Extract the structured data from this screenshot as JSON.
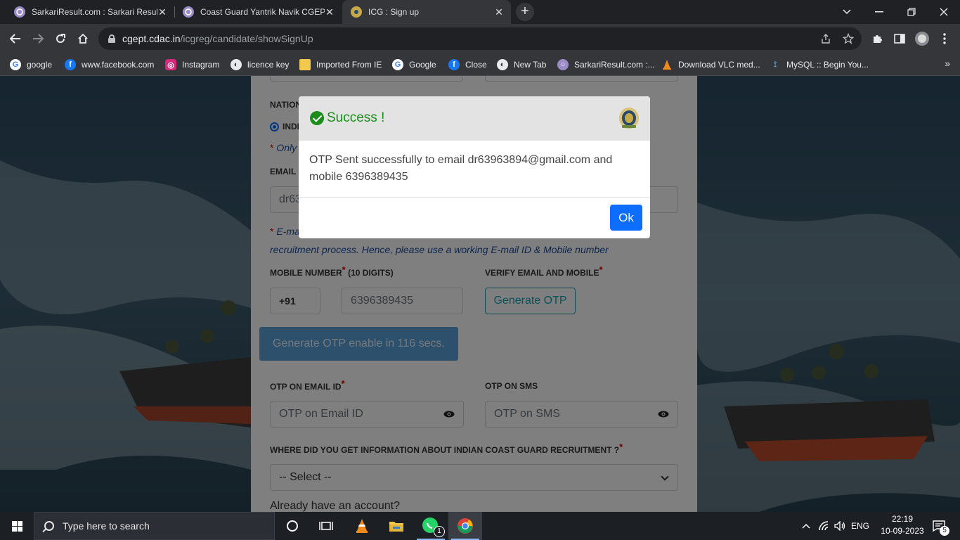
{
  "browser": {
    "tabs": [
      {
        "title": "SarkariResult.com : Sarkari Result",
        "active": false
      },
      {
        "title": "Coast Guard Yantrik Navik CGEPT",
        "active": false
      },
      {
        "title": "ICG : Sign up",
        "active": true
      }
    ],
    "url_host": "cgept.cdac.in",
    "url_path": "/icgreg/candidate/showSignUp",
    "bookmarks": [
      {
        "label": "google",
        "icon": "google-icon"
      },
      {
        "label": "www.facebook.com",
        "icon": "facebook-icon"
      },
      {
        "label": "Instagram",
        "icon": "instagram-icon"
      },
      {
        "label": "licence key",
        "icon": "globe-icon"
      },
      {
        "label": "Imported From IE",
        "icon": "folder-icon"
      },
      {
        "label": "Google",
        "icon": "google-icon"
      },
      {
        "label": "Close",
        "icon": "facebook-icon"
      },
      {
        "label": "New Tab",
        "icon": "globe-icon"
      },
      {
        "label": "SarkariResult.com :...",
        "icon": "sarkari-icon"
      },
      {
        "label": "Download VLC med...",
        "icon": "vlc-icon"
      },
      {
        "label": "MySQL :: Begin You...",
        "icon": "mysql-icon"
      }
    ]
  },
  "form": {
    "nationality_label": "NATION",
    "nationality_value": "INDI",
    "nationality_note": "Only",
    "email_label": "EMAIL I",
    "email_value": "dr63",
    "contact_note_line1": "E-ma",
    "contact_note_line2": "recruitment process. Hence, please use a working E-mail ID & Mobile number",
    "mobile_label": "MOBILE NUMBER",
    "mobile_label_suffix": "(10 DIGITS)",
    "country_code": "+91",
    "mobile_value": "6396389435",
    "verify_label": "VERIFY EMAIL AND MOBILE",
    "generate_otp_label": "Generate OTP",
    "otp_timer_label": "Generate OTP enable in 116 secs.",
    "otp_email_label": "OTP ON EMAIL ID",
    "otp_email_placeholder": "OTP on Email ID",
    "otp_sms_label": "OTP ON SMS",
    "otp_sms_placeholder": "OTP on SMS",
    "source_label": "WHERE DID YOU GET INFORMATION ABOUT INDIAN COAST GUARD RECRUITMENT ?",
    "source_select": "-- Select --",
    "login_prompt": "Already have an account?",
    "required_mark": "*"
  },
  "modal": {
    "title": "Success !",
    "message": "OTP Sent successfully to email dr63963894@gmail.com and mobile 6396389435",
    "ok_label": "Ok"
  },
  "taskbar": {
    "search_placeholder": "Type here to search",
    "language": "ENG",
    "time": "22:19",
    "date": "10-09-2023",
    "whatsapp_badge": "1",
    "notification_count": "5"
  },
  "colors": {
    "success_green": "#1a8d1a",
    "primary_blue": "#0d6efd",
    "required_red": "#dd0000",
    "info_teal": "#17a2b8"
  }
}
